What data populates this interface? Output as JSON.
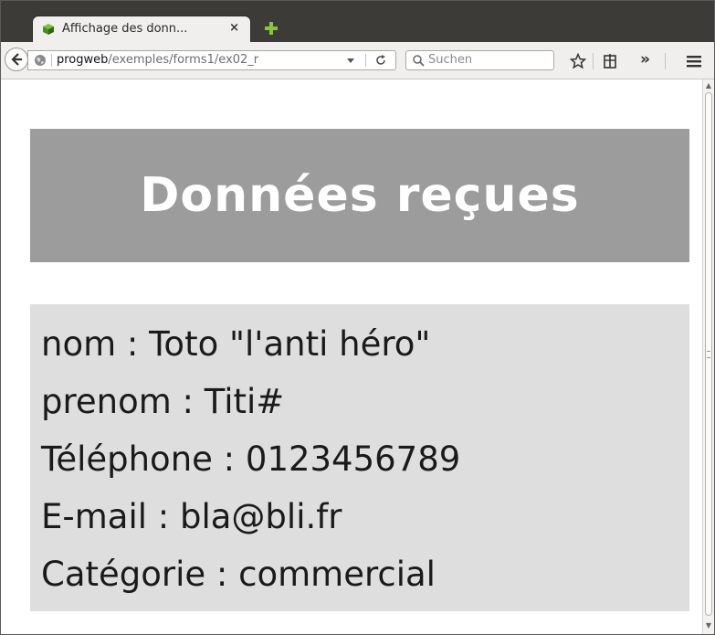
{
  "browser": {
    "tab": {
      "title": "Affichage des donn...",
      "close": "×"
    },
    "url": {
      "host": "progweb",
      "path": "/exemples/forms1/ex02_r"
    },
    "search": {
      "placeholder": "Suchen"
    },
    "overflow": "»"
  },
  "page": {
    "heading": "Données reçues",
    "fields": [
      {
        "text": "nom : Toto \"l'anti héro\""
      },
      {
        "text": "prenom : Titi#"
      },
      {
        "text": "Téléphone : 0123456789"
      },
      {
        "text": "E-mail : bla@bli.fr"
      },
      {
        "text": "Catégorie : commercial"
      }
    ]
  },
  "colors": {
    "heading_bg": "#9c9c9c",
    "data_bg": "#dedede",
    "tabstrip": "#3c3b37",
    "toolbar": "#f0efed"
  },
  "icons": [
    "cube-favicon-icon",
    "new-tab-plus-icon",
    "back-arrow-icon",
    "globe-icon",
    "dropdown-icon",
    "reload-icon",
    "search-icon",
    "star-icon",
    "bookmarks-icon",
    "menu-icon"
  ]
}
